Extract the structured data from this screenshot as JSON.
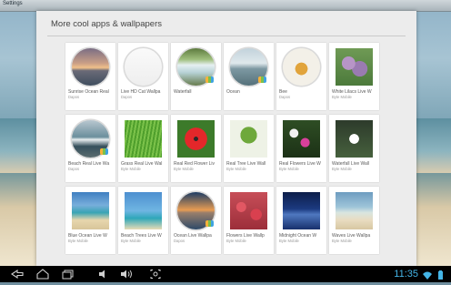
{
  "window": {
    "title": "Settings"
  },
  "dialog": {
    "title": "More cool apps & wallpapers"
  },
  "tiles": [
    {
      "name": "Sunrise Ocean Real",
      "developer": "Dapos",
      "art": "a-sunrise",
      "round": true,
      "badge": false
    },
    {
      "name": "Live HD Cat Wallpa",
      "developer": "Dapos",
      "art": "a-cat",
      "round": true,
      "badge": false
    },
    {
      "name": "Waterfall",
      "developer": "",
      "art": "a-waterfall",
      "round": true,
      "badge": true
    },
    {
      "name": "Ocean",
      "developer": "",
      "art": "a-ocean",
      "round": true,
      "badge": true
    },
    {
      "name": "Bee",
      "developer": "Dapos",
      "art": "a-bee",
      "round": true,
      "badge": false
    },
    {
      "name": "White Lilacs Live W",
      "developer": "Byte Mobile",
      "art": "a-lilac",
      "round": false,
      "badge": false
    },
    {
      "name": "Beach Real Live Wa",
      "developer": "Dapos",
      "art": "a-beach",
      "round": true,
      "badge": true
    },
    {
      "name": "Grass Real Live Wal",
      "developer": "Byte Mobile",
      "art": "a-grass",
      "round": false,
      "badge": false
    },
    {
      "name": "Real Red Flower Liv",
      "developer": "Byte Mobile",
      "art": "a-redflower",
      "round": false,
      "badge": false
    },
    {
      "name": "Real Tree Live Wall",
      "developer": "Byte Mobile",
      "art": "a-tree",
      "round": false,
      "badge": false
    },
    {
      "name": "Real Flowers Live W",
      "developer": "Byte Mobile",
      "art": "a-realflowers",
      "round": false,
      "badge": false
    },
    {
      "name": "Waterfall Live Wall",
      "developer": "Byte Mobile",
      "art": "a-waterfall2",
      "round": false,
      "badge": false
    },
    {
      "name": "Blue Ocean Live W",
      "developer": "Byte Mobile",
      "art": "a-blueocean",
      "round": false,
      "badge": false
    },
    {
      "name": "Beach Trees Live W",
      "developer": "Byte Mobile",
      "art": "a-beachtrees",
      "round": false,
      "badge": false
    },
    {
      "name": "Ocean Live Wallpa",
      "developer": "Dapos",
      "art": "a-oceanlive",
      "round": true,
      "badge": true
    },
    {
      "name": "Flowers Live Wallp",
      "developer": "Byte Mobile",
      "art": "a-flowerslive",
      "round": false,
      "badge": false
    },
    {
      "name": "Midnight Ocean W",
      "developer": "Byte Mobile",
      "art": "a-midnight",
      "round": false,
      "badge": false
    },
    {
      "name": "Waves Live Wallpa",
      "developer": "Byte Mobile",
      "art": "a-waves",
      "round": false,
      "badge": false
    }
  ],
  "navbar": {
    "back_icon": "back-icon",
    "home_icon": "home-icon",
    "recents_icon": "recents-icon",
    "volume_down_icon": "volume-down-icon",
    "volume_up_icon": "volume-up-icon",
    "screenshot_icon": "screenshot-icon",
    "clock": "11:35"
  }
}
